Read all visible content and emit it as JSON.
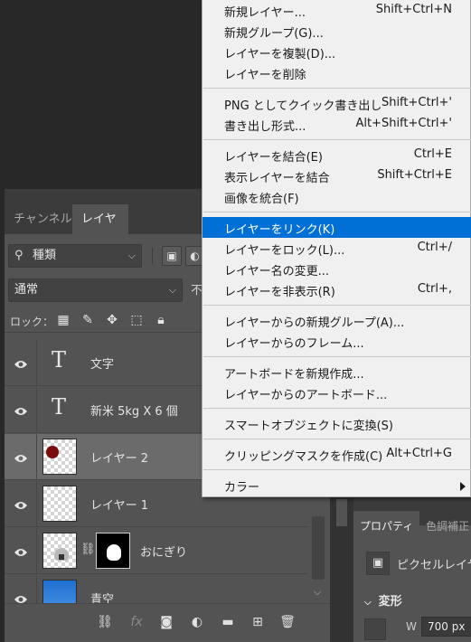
{
  "layers_panel": {
    "tabs": [
      "チャンネル",
      "レイヤー"
    ],
    "filter": {
      "kind_label": "種類"
    },
    "blend_mode": "通常",
    "opacity_label": "不",
    "lock_label": "ロック：",
    "layers": [
      {
        "name": "文字",
        "type": "text",
        "selected": false
      },
      {
        "name": "新米 5kg X 6 個",
        "type": "text",
        "selected": false
      },
      {
        "name": "レイヤー 2",
        "type": "pixel",
        "selected": true
      },
      {
        "name": "レイヤー 1",
        "type": "pixel",
        "selected": false
      },
      {
        "name": "おにぎり",
        "type": "masked",
        "selected": false
      },
      {
        "name": "青空",
        "type": "pixel",
        "selected": false
      }
    ]
  },
  "properties_panel": {
    "tabs": [
      "プロパティ",
      "色調補正"
    ],
    "pixel_layer_label": "ピクセルレイヤ",
    "transform_header": "変形",
    "width_label": "W",
    "width_value": "700 px"
  },
  "context_menu": {
    "highlight_color": "#0070d7",
    "groups": [
      [
        {
          "label": "新規レイヤー...",
          "shortcut": "Shift+Ctrl+N"
        },
        {
          "label": "新規グループ(G)...",
          "shortcut": ""
        },
        {
          "label": "レイヤーを複製(D)...",
          "shortcut": ""
        },
        {
          "label": "レイヤーを削除",
          "shortcut": ""
        }
      ],
      [
        {
          "label": "PNG としてクイック書き出し",
          "shortcut": "Shift+Ctrl+'"
        },
        {
          "label": "書き出し形式...",
          "shortcut": "Alt+Shift+Ctrl+'"
        }
      ],
      [
        {
          "label": "レイヤーを結合(E)",
          "shortcut": "Ctrl+E"
        },
        {
          "label": "表示レイヤーを結合",
          "shortcut": "Shift+Ctrl+E"
        },
        {
          "label": "画像を統合(F)",
          "shortcut": ""
        }
      ],
      [
        {
          "label": "レイヤーをリンク(K)",
          "shortcut": "",
          "highlighted": true
        },
        {
          "label": "レイヤーをロック(L)...",
          "shortcut": "Ctrl+/"
        },
        {
          "label": "レイヤー名の変更...",
          "shortcut": ""
        },
        {
          "label": "レイヤーを非表示(R)",
          "shortcut": "Ctrl+,"
        }
      ],
      [
        {
          "label": "レイヤーからの新規グループ(A)...",
          "shortcut": ""
        },
        {
          "label": "レイヤーからのフレーム...",
          "shortcut": ""
        }
      ],
      [
        {
          "label": "アートボードを新規作成...",
          "shortcut": ""
        },
        {
          "label": "レイヤーからのアートボード...",
          "shortcut": ""
        }
      ],
      [
        {
          "label": "スマートオブジェクトに変換(S)",
          "shortcut": ""
        }
      ],
      [
        {
          "label": "クリッピングマスクを作成(C)",
          "shortcut": "Alt+Ctrl+G"
        }
      ],
      [
        {
          "label": "カラー",
          "shortcut": "",
          "submenu": true
        }
      ]
    ]
  }
}
